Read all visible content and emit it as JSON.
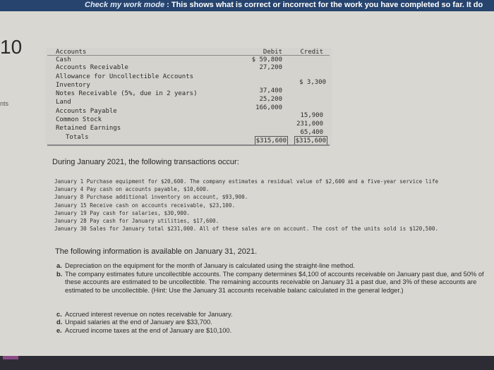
{
  "header": {
    "mode_label": "Check my work mode",
    "message": " : This shows what is correct or incorrect for the work you have completed so far. It do"
  },
  "question_number": "10",
  "points_label": "nts",
  "trial_balance": {
    "headers": {
      "account": "Accounts",
      "debit": "Debit",
      "credit": "Credit"
    },
    "rows": [
      {
        "account": "Cash",
        "debit": "$ 59,800",
        "credit": ""
      },
      {
        "account": "Accounts Receivable",
        "debit": "27,200",
        "credit": ""
      },
      {
        "account": "Allowance for Uncollectible Accounts",
        "debit": "",
        "credit": "$  3,300"
      },
      {
        "account": "Inventory",
        "debit": "37,400",
        "credit": ""
      },
      {
        "account": "Notes Receivable (5%, due in 2 years)",
        "debit": "25,200",
        "credit": ""
      },
      {
        "account": "Land",
        "debit": "166,000",
        "credit": ""
      },
      {
        "account": "Accounts Payable",
        "debit": "",
        "credit": "15,900"
      },
      {
        "account": "Common Stock",
        "debit": "",
        "credit": "231,000"
      },
      {
        "account": "Retained Earnings",
        "debit": "",
        "credit": "65,400"
      }
    ],
    "totals": {
      "label": "Totals",
      "debit": "$315,600",
      "credit": "$315,600"
    }
  },
  "transactions_title": "During January 2021, the following transactions occur:",
  "transactions": [
    "January  1 Purchase equipment for $20,600. The company estimates a residual value of $2,600 and a five-year service life",
    "January  4 Pay cash on accounts payable, $10,600.",
    "January  8 Purchase additional inventory on account, $93,900.",
    "January 15 Receive cash on accounts receivable, $23,100.",
    "January 19 Pay cash for salaries, $30,900.",
    "January 28 Pay cash for January utilities, $17,600.",
    "January 30 Sales for January total $231,000. All of these sales are on account. The cost of the units sold is $120,500."
  ],
  "info_title": "The following information is available on January 31, 2021.",
  "notes": [
    {
      "label": "a.",
      "text": "Depreciation on the equipment for the month of January is calculated using the straight-line method."
    },
    {
      "label": "b.",
      "text": "The company estimates future uncollectible accounts. The company determines $4,100 of accounts receivable on January past due, and 50% of these accounts are estimated to be uncollectible. The remaining accounts receivable on January 31 a past due, and 3% of these accounts are estimated to be uncollectible. (Hint: Use the January 31 accounts receivable balanc calculated in the general ledger.)"
    },
    {
      "label": "c.",
      "text": "Accrued interest revenue on notes receivable for January."
    },
    {
      "label": "d.",
      "text": "Unpaid salaries at the end of January are $33,700."
    },
    {
      "label": "e.",
      "text": "Accrued income taxes at the end of January are $10,100."
    }
  ]
}
